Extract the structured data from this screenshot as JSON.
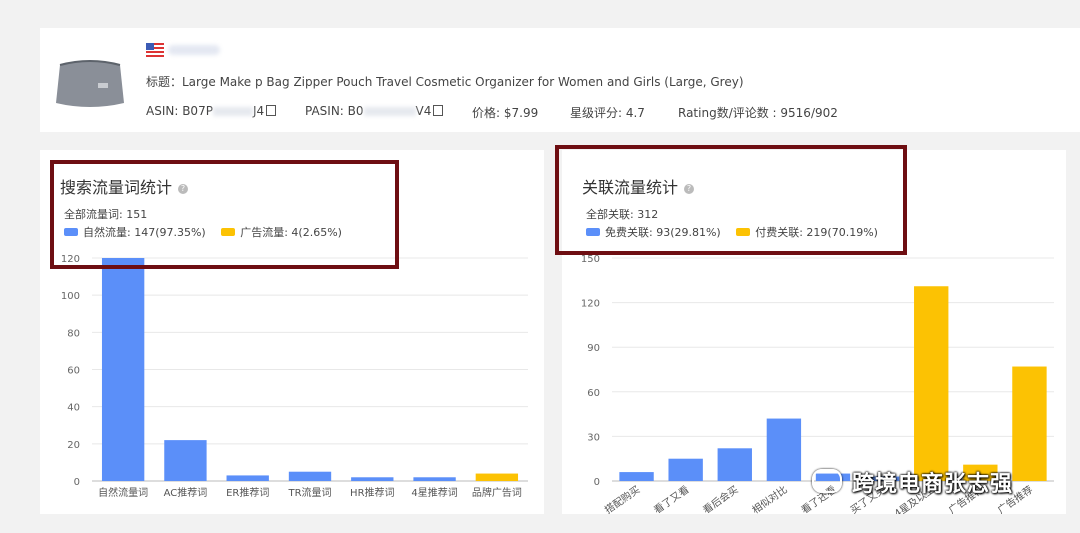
{
  "product": {
    "title": "标题：Large Make  p Bag Zipper Pouch Travel Cosmetic Organizer for Women and Girls (Large, Grey)",
    "asin": "ASIN: B07P",
    "asin_tail": "J4",
    "pasin": "PASIN: B0",
    "pasin_tail": "V4",
    "price": "价格: $7.99",
    "stars": "星级评分: 4.7",
    "rating": "Rating数/评论数 : 9516/902"
  },
  "left_panel": {
    "title": "搜索流量词统计",
    "total": "全部流量词: 151",
    "legend": [
      {
        "label": "自然流量: 147(97.35%)",
        "color": "#5b8ff9"
      },
      {
        "label": "广告流量: 4(2.65%)",
        "color": "#fcc203"
      }
    ]
  },
  "right_panel": {
    "title": "关联流量统计",
    "total": "全部关联: 312",
    "legend": [
      {
        "label": "免费关联: 93(29.81%)",
        "color": "#5b8ff9"
      },
      {
        "label": "付费关联: 219(70.19%)",
        "color": "#fcc203"
      }
    ]
  },
  "watermark": "跨境电商张志强",
  "chart_data": [
    {
      "type": "bar",
      "categories": [
        "自然流量词",
        "AC推荐词",
        "ER推荐词",
        "TR流量词",
        "HR推荐词",
        "4星推荐词",
        "品牌广告词"
      ],
      "values": [
        147,
        22,
        3,
        5,
        2,
        2,
        4
      ],
      "colors": [
        "#5b8ff9",
        "#5b8ff9",
        "#5b8ff9",
        "#5b8ff9",
        "#5b8ff9",
        "#5b8ff9",
        "#fcc203"
      ],
      "yticks": [
        0,
        20,
        40,
        60,
        80,
        100,
        120
      ],
      "ylim": [
        0,
        120
      ],
      "grid": true
    },
    {
      "type": "bar",
      "categories": [
        "搭配购买",
        "看了又看",
        "看后会买",
        "相似对比",
        "看了还看",
        "买了又买",
        "4星及以上",
        "广告推荐",
        "广告推荐"
      ],
      "values": [
        6,
        15,
        22,
        42,
        5,
        3,
        131,
        11,
        77
      ],
      "colors": [
        "#5b8ff9",
        "#5b8ff9",
        "#5b8ff9",
        "#5b8ff9",
        "#5b8ff9",
        "#5b8ff9",
        "#fcc203",
        "#fcc203",
        "#fcc203"
      ],
      "yticks": [
        0,
        30,
        60,
        90,
        120,
        150
      ],
      "ylim": [
        0,
        150
      ],
      "grid": true
    }
  ]
}
